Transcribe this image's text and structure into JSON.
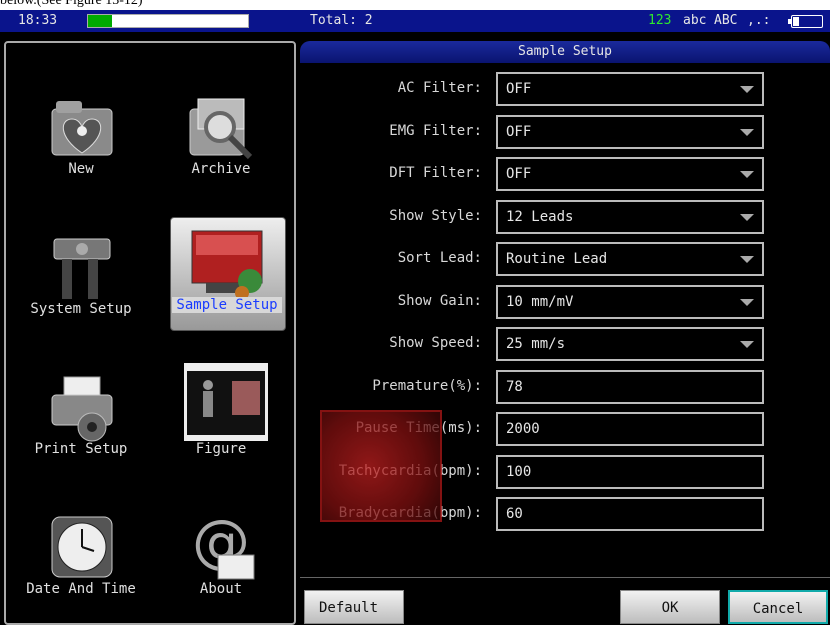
{
  "caption": "below.(See Figure 13-12)",
  "statusbar": {
    "time": "18:33",
    "progress": 0.15,
    "total": "Total: 2",
    "im_numeric": "123",
    "im_lower": "abc",
    "im_upper": "ABC",
    "im_punct": ",.:"
  },
  "menu": [
    {
      "label": "New",
      "icon": "folder-heart-icon"
    },
    {
      "label": "Archive",
      "icon": "magnifier-folder-icon"
    },
    {
      "label": "System Setup",
      "icon": "tools-icon"
    },
    {
      "label": "Sample Setup",
      "icon": "sample-screen-icon",
      "selected": true
    },
    {
      "label": "Print Setup",
      "icon": "printer-icon"
    },
    {
      "label": "Figure",
      "icon": "figure-icon"
    },
    {
      "label": "Date And Time",
      "icon": "clock-icon"
    },
    {
      "label": "About",
      "icon": "at-sign-icon"
    }
  ],
  "panel": {
    "title": "Sample Setup",
    "fields": [
      {
        "label": "AC Filter:",
        "value": "OFF",
        "dropdown": true
      },
      {
        "label": "EMG Filter:",
        "value": "OFF",
        "dropdown": true
      },
      {
        "label": "DFT Filter:",
        "value": "OFF",
        "dropdown": true
      },
      {
        "label": "Show Style:",
        "value": "12 Leads",
        "dropdown": true
      },
      {
        "label": "Sort Lead:",
        "value": "Routine Lead",
        "dropdown": true
      },
      {
        "label": "Show Gain:",
        "value": "10 mm/mV",
        "dropdown": true
      },
      {
        "label": "Show Speed:",
        "value": "25 mm/s",
        "dropdown": true
      },
      {
        "label": "Premature(%):",
        "value": "78",
        "dropdown": false
      },
      {
        "label": "Pause Time(ms):",
        "value": "2000",
        "dropdown": false
      },
      {
        "label": "Tachycardia(bpm):",
        "value": "100",
        "dropdown": false
      },
      {
        "label": "Bradycardia(bpm):",
        "value": "60",
        "dropdown": false
      }
    ],
    "buttons": {
      "default": "Default",
      "ok": "OK",
      "cancel": "Cancel"
    }
  },
  "colors": {
    "statusbar": "#0a148c",
    "selected_label": "#1a3cff",
    "im_active": "#2ee82e"
  }
}
